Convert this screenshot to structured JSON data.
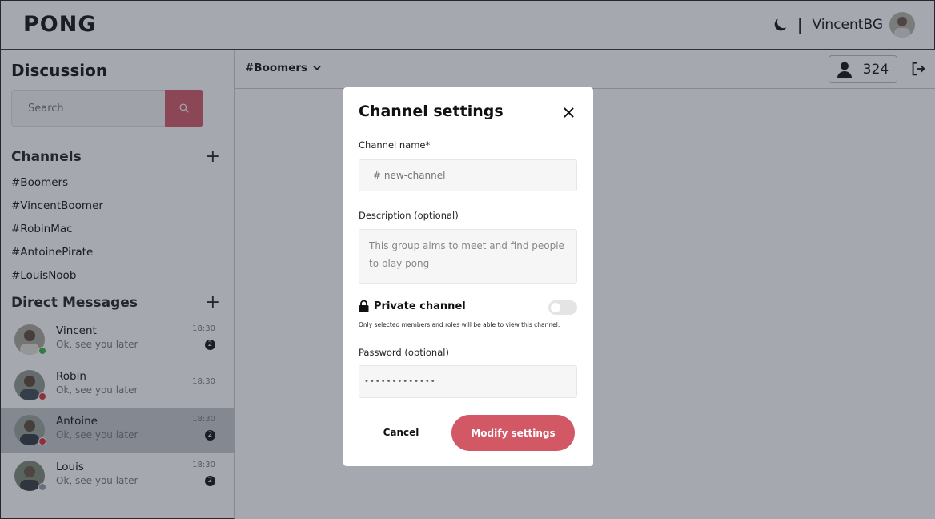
{
  "app": {
    "logo": "PONG"
  },
  "header": {
    "username": "VincentBG",
    "separator": "|",
    "theme_icon": "moon-icon"
  },
  "sidebar": {
    "title": "Discussion",
    "search": {
      "placeholder": "Search"
    },
    "channels_title": "Channels",
    "channels": [
      "#Boomers",
      "#VincentBoomer",
      "#RobinMac",
      "#AntoinePirate",
      "#LouisNoob"
    ],
    "dm_title": "Direct Messages",
    "dms": [
      {
        "name": "Vincent",
        "message": "Ok, see you later",
        "time": "18:30",
        "badge": "2",
        "status_color": "#3bb54a"
      },
      {
        "name": "Robin",
        "message": "Ok, see you later",
        "time": "18:30",
        "badge": "",
        "status_color": "#e0303c"
      },
      {
        "name": "Antoine",
        "message": "Ok, see you later",
        "time": "18:30",
        "badge": "2",
        "status_color": "#e0303c"
      },
      {
        "name": "Louis",
        "message": "Ok, see you later",
        "time": "18:30",
        "badge": "2",
        "status_color": "#9a9ca3"
      }
    ]
  },
  "topbar": {
    "channel": "#Boomers",
    "members": "324"
  },
  "modal": {
    "title": "Channel settings",
    "channel_name_label": "Channel name*",
    "channel_name_placeholder": "# new-channel",
    "description_label": "Description (optional)",
    "description_value": "This group aims to meet and find people to play pong",
    "private_label": "Private channel",
    "private_enabled": false,
    "private_hint": "Only selected members and roles will be able to view this channel.",
    "password_label": "Password (optional)",
    "password_value": "•••••••••••••",
    "cancel_label": "Cancel",
    "submit_label": "Modify settings"
  },
  "colors": {
    "accent": "#d35866",
    "overlay": "#28303e"
  }
}
